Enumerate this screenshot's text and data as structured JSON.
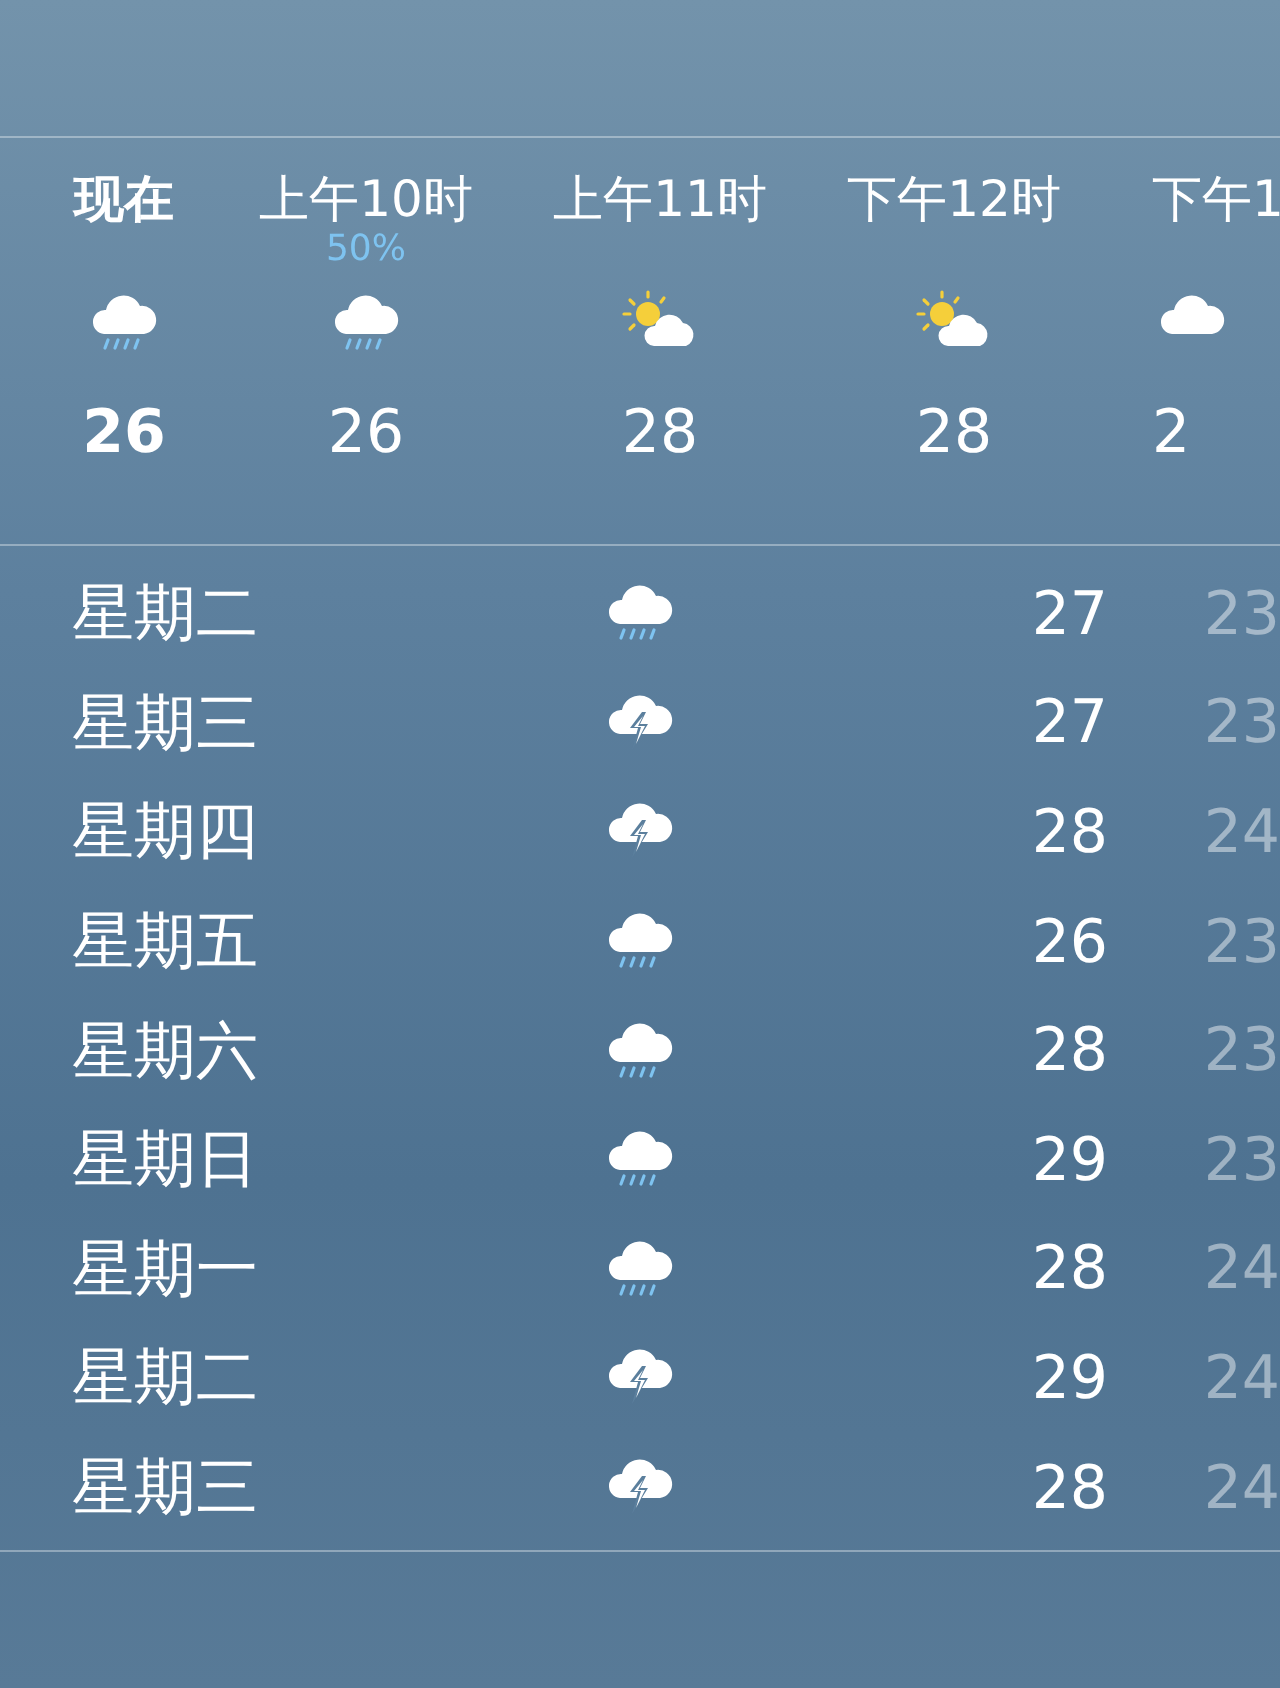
{
  "hourly": [
    {
      "time": "现在",
      "kind": "rain",
      "temp": "26",
      "now": true
    },
    {
      "time": "上午10时",
      "precip": "50%",
      "kind": "rain",
      "temp": "26",
      "now": false
    },
    {
      "time": "上午11时",
      "kind": "partly_cloudy",
      "temp": "28",
      "now": false
    },
    {
      "time": "下午12时",
      "kind": "partly_cloudy",
      "temp": "28",
      "now": false
    },
    {
      "time": "下午1",
      "kind": "cloud",
      "temp": "2",
      "now": false
    }
  ],
  "daily": [
    {
      "day": "星期二",
      "kind": "rain",
      "high": "27",
      "low": "23"
    },
    {
      "day": "星期三",
      "kind": "thunder",
      "high": "27",
      "low": "23"
    },
    {
      "day": "星期四",
      "kind": "thunder",
      "high": "28",
      "low": "24"
    },
    {
      "day": "星期五",
      "kind": "rain",
      "high": "26",
      "low": "23"
    },
    {
      "day": "星期六",
      "kind": "rain",
      "high": "28",
      "low": "23"
    },
    {
      "day": "星期日",
      "kind": "rain",
      "high": "29",
      "low": "23"
    },
    {
      "day": "星期一",
      "kind": "rain",
      "high": "28",
      "low": "24"
    },
    {
      "day": "星期二",
      "kind": "thunder",
      "high": "29",
      "low": "24"
    },
    {
      "day": "星期三",
      "kind": "thunder",
      "high": "28",
      "low": "24"
    }
  ]
}
